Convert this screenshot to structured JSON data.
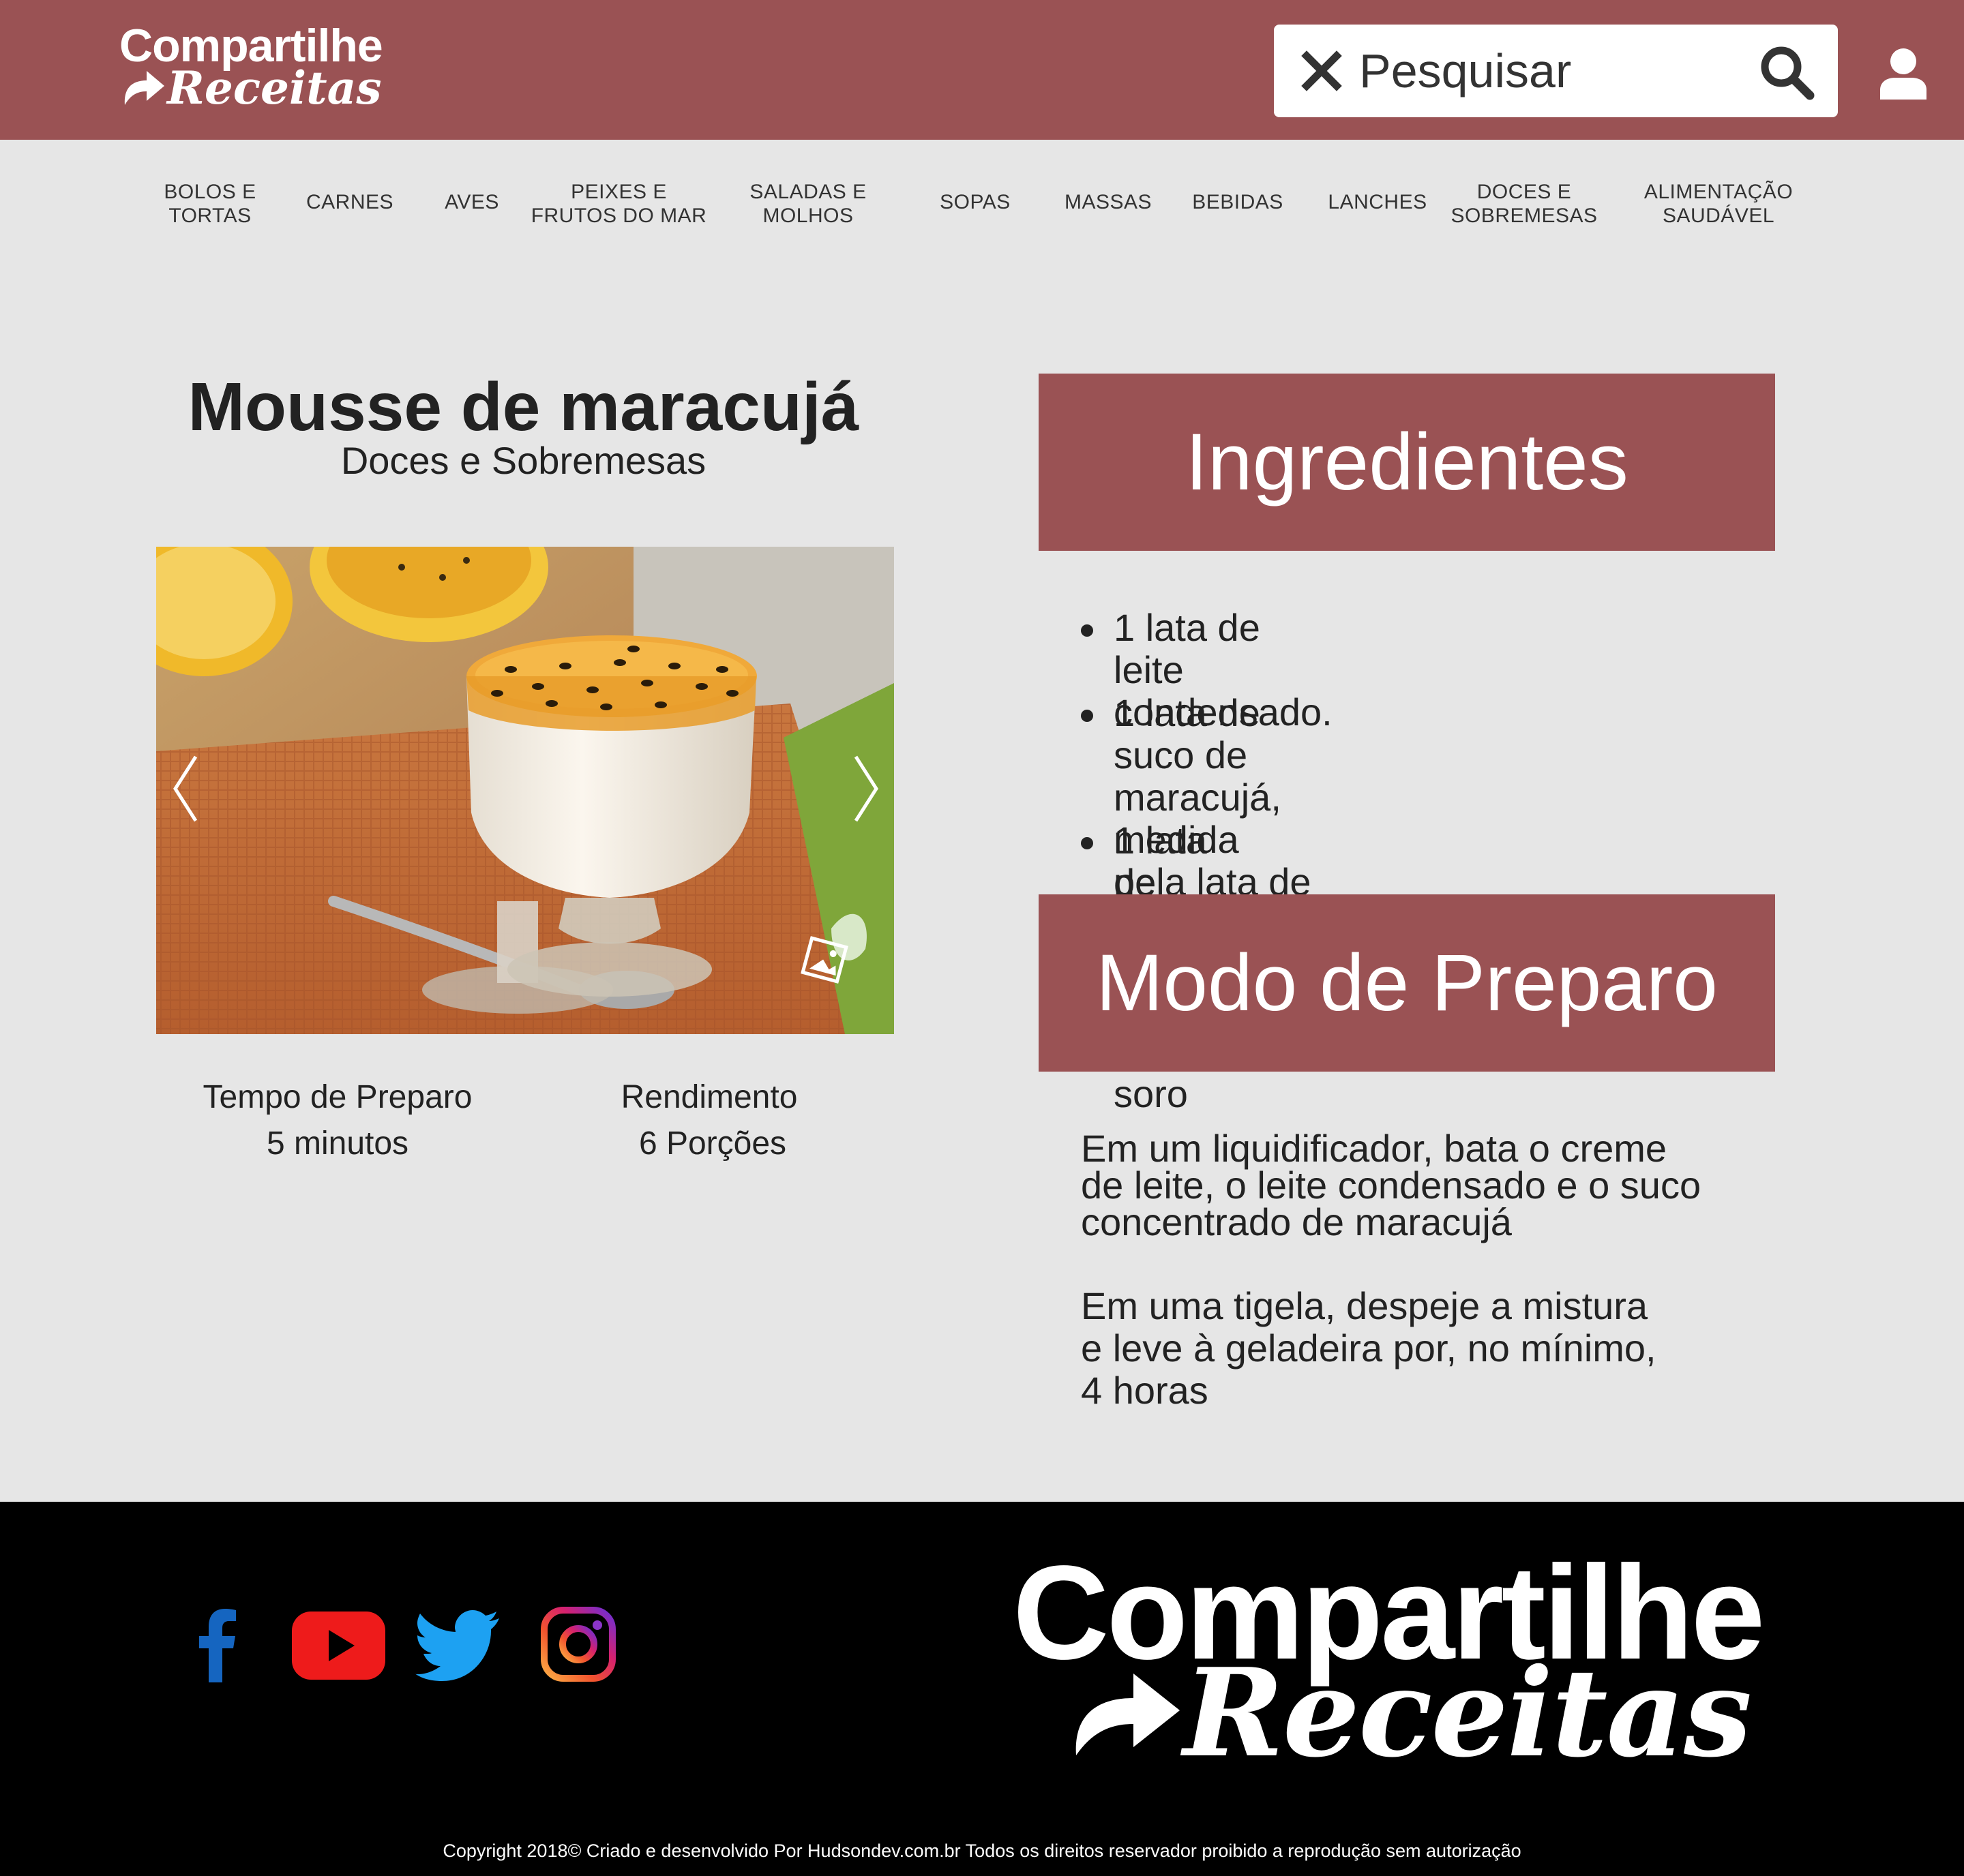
{
  "header": {
    "logo_line1": "Compartilhe",
    "logo_line2": "Receitas",
    "search_placeholder": "Pesquisar"
  },
  "nav": [
    {
      "label": "BOLOS E\nTORTAS"
    },
    {
      "label": "CARNES"
    },
    {
      "label": "AVES"
    },
    {
      "label": "PEIXES E\nFRUTOS DO MAR"
    },
    {
      "label": "SALADAS  E\nMOLHOS"
    },
    {
      "label": "SOPAS"
    },
    {
      "label": "MASSAS"
    },
    {
      "label": "BEBIDAS"
    },
    {
      "label": "LANCHES"
    },
    {
      "label": "DOCES E\nSOBREMESAS"
    },
    {
      "label": "ALIMENTAÇÃO\nSAUDÁVEL"
    }
  ],
  "recipe": {
    "title": "Mousse de maracujá",
    "category": "Doces e Sobremesas",
    "prep_label": "Tempo de Preparo",
    "prep_value": "5 minutos",
    "yield_label": "Rendimento",
    "yield_value": "6 Porções"
  },
  "ingredients": {
    "heading": "Ingredientes",
    "items": [
      "1 lata de leite condensado.",
      "1 lata de suco de maracujá, medida\npela lata de leite condensado.",
      "1 lata de creme de leite sem soro"
    ]
  },
  "preparation": {
    "heading": "Modo de Preparo",
    "steps": [
      "Em um liquidificador, bata o creme\nde leite, o leite condensado e o suco\nconcentrado de maracujá",
      "Em uma tigela, despeje a mistura\ne leve à geladeira por, no mínimo,\n4 horas"
    ]
  },
  "footer": {
    "logo_line1": "Compartilhe",
    "logo_line2": "Receitas",
    "copyright": "Copyright 2018© Criado e desenvolvido Por Hudsondev.com.br  Todos os direitos reservador proibido a reprodução sem autorização"
  },
  "colors": {
    "brand": "#9a5254",
    "background": "#e6e6e6",
    "footer": "#000000",
    "facebook": "#1565c0",
    "youtube": "#ee1b1b",
    "twitter": "#1da1f2"
  },
  "icons": [
    "close-icon",
    "search-icon",
    "user-icon",
    "chevron-left-icon",
    "chevron-right-icon",
    "image-icon",
    "facebook-icon",
    "youtube-icon",
    "twitter-icon",
    "instagram-icon"
  ]
}
